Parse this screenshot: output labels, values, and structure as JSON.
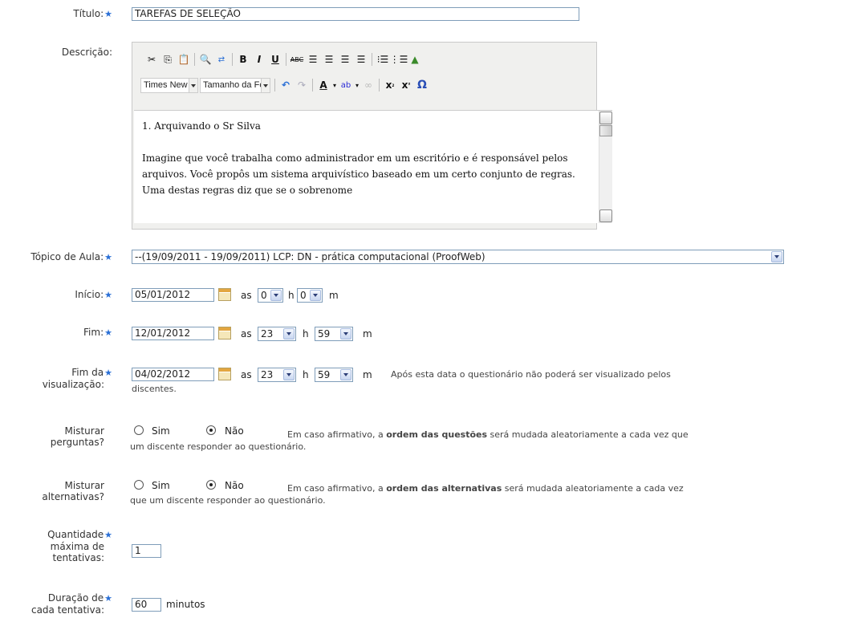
{
  "titulo": {
    "label": "Título:",
    "value": "TAREFAS DE SELEÇÃO"
  },
  "descricao": {
    "label": "Descrição:",
    "toolbar": {
      "font_family": "Times New Ror",
      "font_size": "Tamanho da Fc"
    },
    "paragraphs": [
      "1. Arquivando o Sr Silva",
      "Imagine que você trabalha como administrador em um escritório e é responsável pelos arquivos.  Você propôs um sistema arquivístico baseado em um certo conjunto de regras.  Uma destas regras diz que se o sobrenome"
    ]
  },
  "topico": {
    "label": "Tópico de Aula:",
    "value": "--(19/09/2011 - 19/09/2011) LCP: DN - prática computacional (ProofWeb)"
  },
  "inicio": {
    "label": "Início:",
    "date": "05/01/2012",
    "as": "as",
    "hour": "0",
    "h": "h",
    "minute": "0",
    "m": "m"
  },
  "fim": {
    "label": "Fim:",
    "date": "12/01/2012",
    "as": "as",
    "hour": "23",
    "h": "h",
    "minute": "59",
    "m": "m"
  },
  "fim_visualizacao": {
    "label_line1": "Fim da",
    "label_line2": "visualização:",
    "date": "04/02/2012",
    "as": "as",
    "hour": "23",
    "h": "h",
    "minute": "59",
    "m": "m",
    "hint_line1": "Após esta data o questionário não poderá ser visualizado pelos",
    "hint_line2": "discentes."
  },
  "misturar_perguntas": {
    "label_line1": "Misturar",
    "label_line2": "perguntas?",
    "opt_sim": "Sim",
    "opt_nao": "Não",
    "selected": "Não",
    "hint_pre": "Em caso afirmativo, a ",
    "hint_bold": "ordem das questões",
    "hint_post": " será mudada aleatoriamente a cada vez que",
    "hint_line2": "um discente responder ao questionário."
  },
  "misturar_alternativas": {
    "label_line1": "Misturar",
    "label_line2": "alternativas?",
    "opt_sim": "Sim",
    "opt_nao": "Não",
    "selected": "Não",
    "hint_pre": "Em caso afirmativo, a ",
    "hint_bold": "ordem das alternativas",
    "hint_post": " será mudada aleatoriamente a cada vez",
    "hint_line2": "que um discente responder ao questionário."
  },
  "quantidade": {
    "label_line1": "Quantidade",
    "label_line2": "máxima de",
    "label_line3": "tentativas:",
    "value": "1"
  },
  "duracao": {
    "label_line1": "Duração de",
    "label_line2": "cada tentativa:",
    "value": "60",
    "unit": "minutos"
  },
  "colors": {
    "required_star": "#2a6fd6",
    "input_border": "#7f9db9"
  }
}
